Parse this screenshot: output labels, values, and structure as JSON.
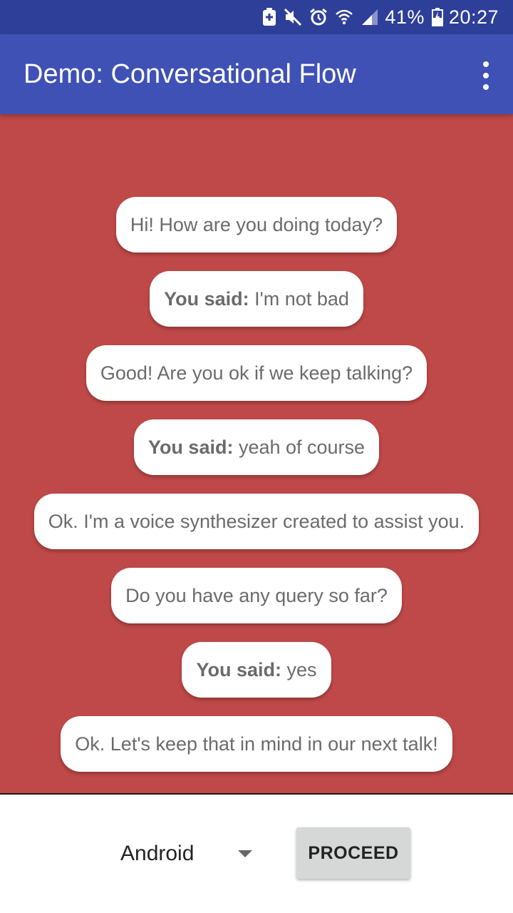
{
  "status_bar": {
    "battery_percent": "41%",
    "time": "20:27",
    "icons": [
      "notification-icon",
      "mute-icon",
      "alarm-icon",
      "wifi-icon",
      "signal-icon",
      "battery-charging-icon"
    ]
  },
  "app_bar": {
    "title": "Demo: Conversational Flow",
    "menu_icon": "overflow-menu-icon"
  },
  "colors": {
    "status_bar": "#2e3f99",
    "app_bar": "#3f51b5",
    "conversation_background": "#bf4848",
    "bubble_background": "#ffffff",
    "bubble_text": "#6b6b6b",
    "button_background": "#d6d7d7"
  },
  "conversation": {
    "messages": [
      {
        "prefix": "",
        "text": "Hi! How are you doing today?"
      },
      {
        "prefix": "You said:",
        "text": "I'm not bad"
      },
      {
        "prefix": "",
        "text": "Good! Are you ok if we keep talking?"
      },
      {
        "prefix": "You said:",
        "text": "yeah of course"
      },
      {
        "prefix": "",
        "text": "Ok. I'm a voice synthesizer created to assist you."
      },
      {
        "prefix": "",
        "text": "Do you have any query so far?"
      },
      {
        "prefix": "You said:",
        "text": "yes"
      },
      {
        "prefix": "",
        "text": "Ok. Let's keep that in mind in our next talk!"
      }
    ]
  },
  "controls": {
    "spinner_value": "Android",
    "proceed_label": "PROCEED"
  }
}
